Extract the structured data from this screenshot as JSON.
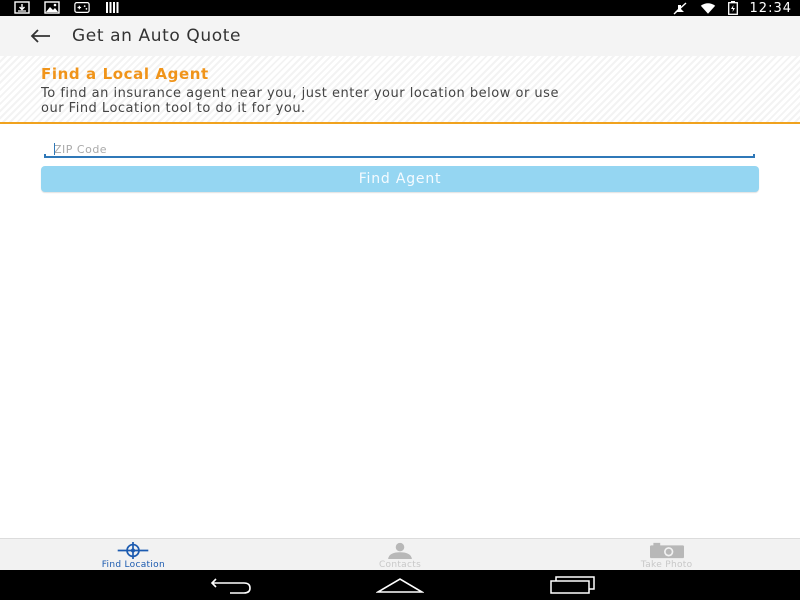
{
  "status_bar": {
    "time": "12:34",
    "icons": [
      "download-icon",
      "image-icon",
      "gamepad-icon",
      "signal-bars-icon",
      "mute-icon",
      "wifi-icon",
      "battery-icon"
    ]
  },
  "app_bar": {
    "title": "Get an Auto Quote",
    "back_icon": "arrow-left-icon"
  },
  "banner": {
    "title": "Find a Local Agent",
    "text_line1": "To find an insurance agent near you, just enter your location below or use",
    "text_line2": "our Find Location tool to do it for you."
  },
  "form": {
    "zip_placeholder": "ZIP Code",
    "zip_value": "",
    "find_button_label": "Find Agent"
  },
  "tabs": [
    {
      "label": "Find Location",
      "icon": "crosshair-icon",
      "active": true
    },
    {
      "label": "Contacts",
      "icon": "person-icon",
      "active": false
    },
    {
      "label": "Take Photo",
      "icon": "camera-icon",
      "active": false
    }
  ],
  "colors": {
    "accent_orange": "#f0941a",
    "button_blue": "#95d6f2",
    "active_tab_blue": "#1c5bb0",
    "underline_blue": "#2f78b8"
  },
  "nav_bar": {
    "buttons": [
      "back-nav-icon",
      "home-nav-icon",
      "recents-nav-icon"
    ]
  }
}
